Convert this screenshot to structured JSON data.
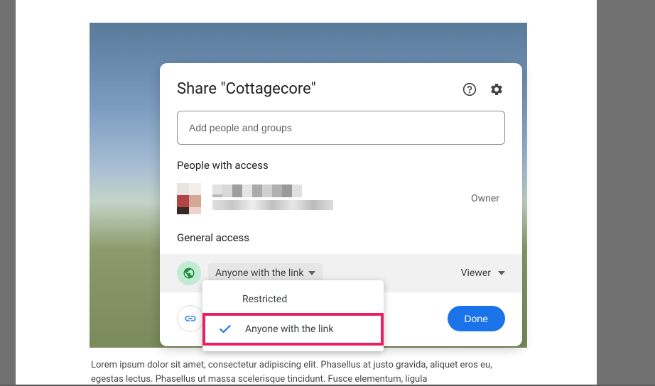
{
  "dialog": {
    "title": "Share \"Cottagecore\"",
    "addPeoplePlaceholder": "Add people and groups",
    "peopleWithAccessLabel": "People with access",
    "ownerRole": "Owner",
    "generalAccessLabel": "General access",
    "accessDropdownLabel": "Anyone with the link",
    "viewerLabel": "Viewer",
    "doneLabel": "Done"
  },
  "dropdown": {
    "option1": "Restricted",
    "option2": "Anyone with the link"
  },
  "lorem": "Lorem ipsum dolor sit amet, consectetur adipiscing elit. Phasellus at justo gravida, aliquet eros eu, egestas lectus. Phasellus ut massa scelerisque tincidunt. Fusce elementum, ligula"
}
